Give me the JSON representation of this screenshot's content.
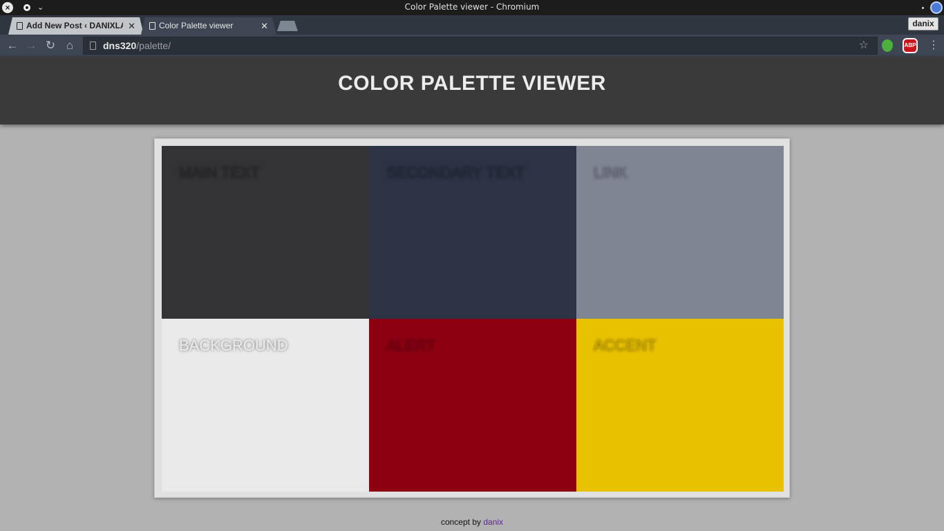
{
  "window": {
    "title": "Color Palette viewer - Chromium"
  },
  "tabs": [
    {
      "label": "Add New Post ‹ DANIXLAND",
      "active": false
    },
    {
      "label": "Color Palette viewer",
      "active": true
    }
  ],
  "profile": {
    "name": "danix"
  },
  "address_bar": {
    "host": "dns320",
    "path": "/palette/"
  },
  "extensions": {
    "abp_label": "ABP"
  },
  "page": {
    "title": "COLOR PALETTE VIEWER",
    "swatches": [
      {
        "label": "MAIN TEXT",
        "color": "#333335",
        "text_color": "#2a2a2c"
      },
      {
        "label": "SECONDARY TEXT",
        "color": "#2c3344",
        "text_color": "#252b39"
      },
      {
        "label": "LINK",
        "color": "#7f8592",
        "text_color": "#6d737f"
      },
      {
        "label": "BACKGROUND",
        "color": "#eaeaea",
        "text_color": "#ececec"
      },
      {
        "label": "ALERT",
        "color": "#8c0012",
        "text_color": "#7a0010"
      },
      {
        "label": "ACCENT",
        "color": "#e8c100",
        "text_color": "#c9a600"
      }
    ],
    "footer": {
      "prefix": "concept by",
      "author": "danix"
    }
  },
  "colors": {
    "header_bg": "#3a3a3a",
    "page_bg": "#b2b2b2",
    "footer_link": "#5a2a8a"
  },
  "icons": {
    "os_close": "close-icon",
    "back": "arrow-left-icon",
    "forward": "arrow-right-icon",
    "reload": "reload-icon",
    "home": "home-icon",
    "bookmark": "star-icon",
    "menu": "kebab-menu-icon"
  }
}
